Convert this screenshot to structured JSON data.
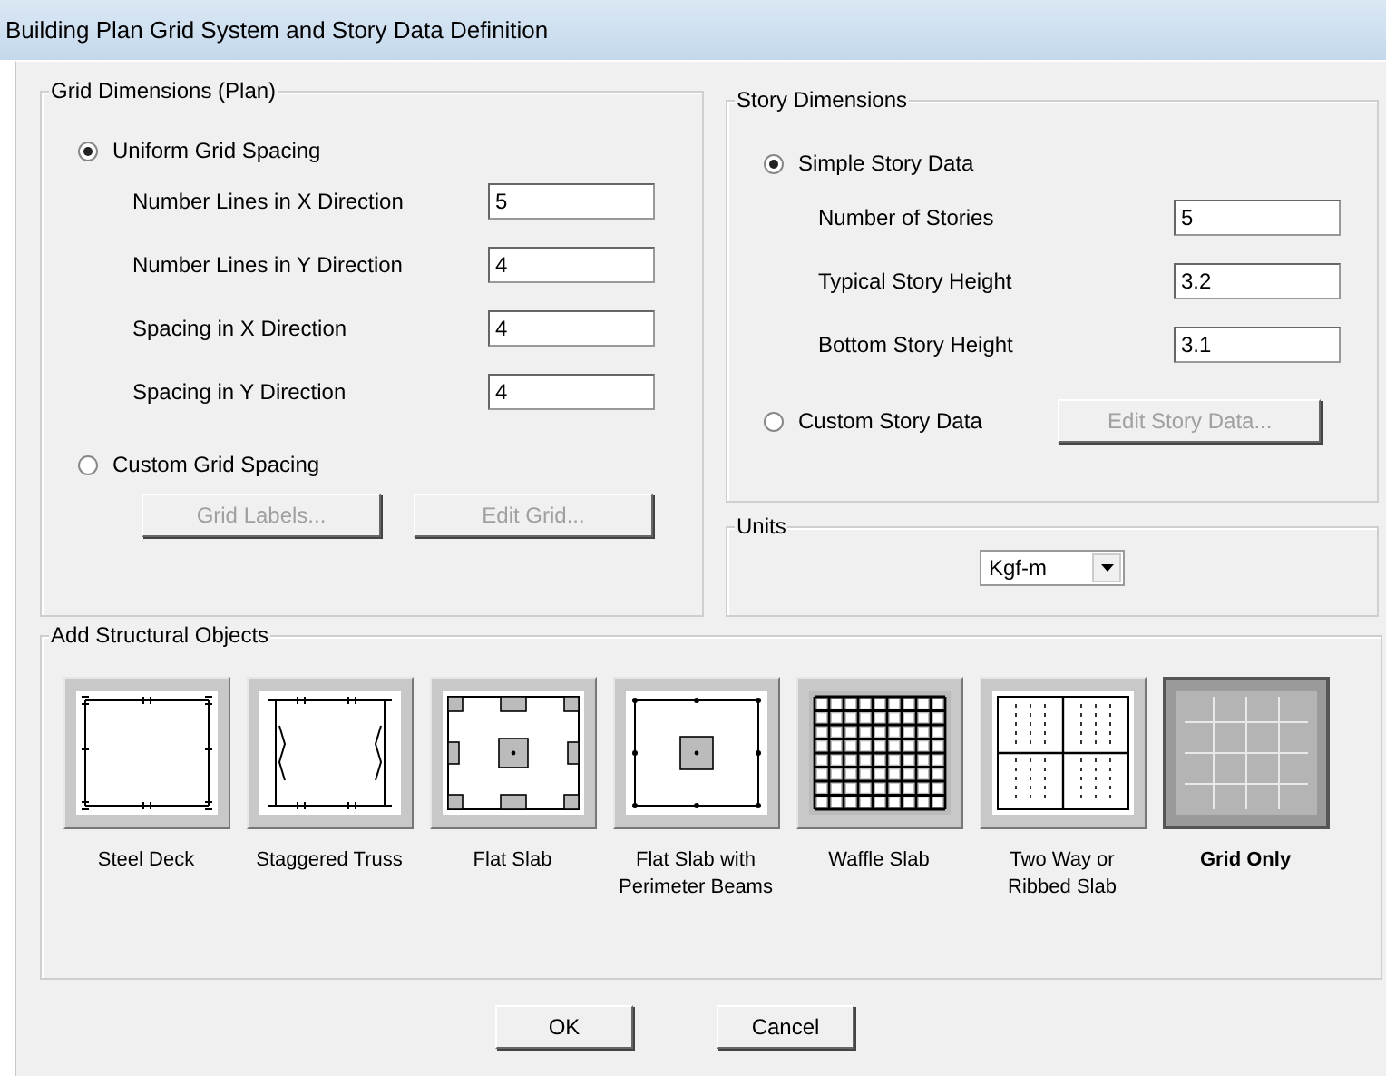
{
  "window": {
    "title": "Building Plan Grid System and Story Data Definition"
  },
  "grid_dimensions": {
    "title": "Grid Dimensions (Plan)",
    "options": [
      {
        "label": "Uniform Grid Spacing",
        "selected": true,
        "fields": [
          {
            "label": "Number Lines in X Direction",
            "value": "5"
          },
          {
            "label": "Number Lines in Y Direction",
            "value": "4"
          },
          {
            "label": "Spacing in X Direction",
            "value": "4"
          },
          {
            "label": "Spacing in Y Direction",
            "value": "4"
          }
        ]
      },
      {
        "label": "Custom Grid Spacing",
        "selected": false
      }
    ],
    "buttons": [
      {
        "label": "Grid Labels...",
        "disabled": true
      },
      {
        "label": "Edit Grid...",
        "disabled": true
      }
    ]
  },
  "story_dimensions": {
    "title": "Story Dimensions",
    "options": [
      {
        "label": "Simple Story Data",
        "selected": true,
        "fields": [
          {
            "label": "Number of Stories",
            "value": "5"
          },
          {
            "label": "Typical Story Height",
            "value": "3.2"
          },
          {
            "label": "Bottom Story Height",
            "value": "3.1"
          }
        ]
      },
      {
        "label": "Custom Story Data",
        "selected": false,
        "button": {
          "label": "Edit Story Data...",
          "disabled": true
        }
      }
    ]
  },
  "units": {
    "title": "Units",
    "value": "Kgf-m"
  },
  "structural_objects": {
    "title": "Add Structural Objects",
    "items": [
      {
        "kind": "steeldeck",
        "label": "Steel Deck",
        "selected": false
      },
      {
        "kind": "truss",
        "label": "Staggered Truss",
        "selected": false
      },
      {
        "kind": "flatslab",
        "label": "Flat Slab",
        "selected": false
      },
      {
        "kind": "perimeter",
        "label": "Flat Slab with Perimeter Beams",
        "selected": false
      },
      {
        "kind": "waffle",
        "label": "Waffle Slab",
        "selected": false
      },
      {
        "kind": "twoway",
        "label": "Two Way or Ribbed Slab",
        "selected": false
      },
      {
        "kind": "grid",
        "label": "Grid Only",
        "selected": true
      }
    ]
  },
  "buttons": [
    {
      "label": "OK"
    },
    {
      "label": "Cancel"
    }
  ]
}
